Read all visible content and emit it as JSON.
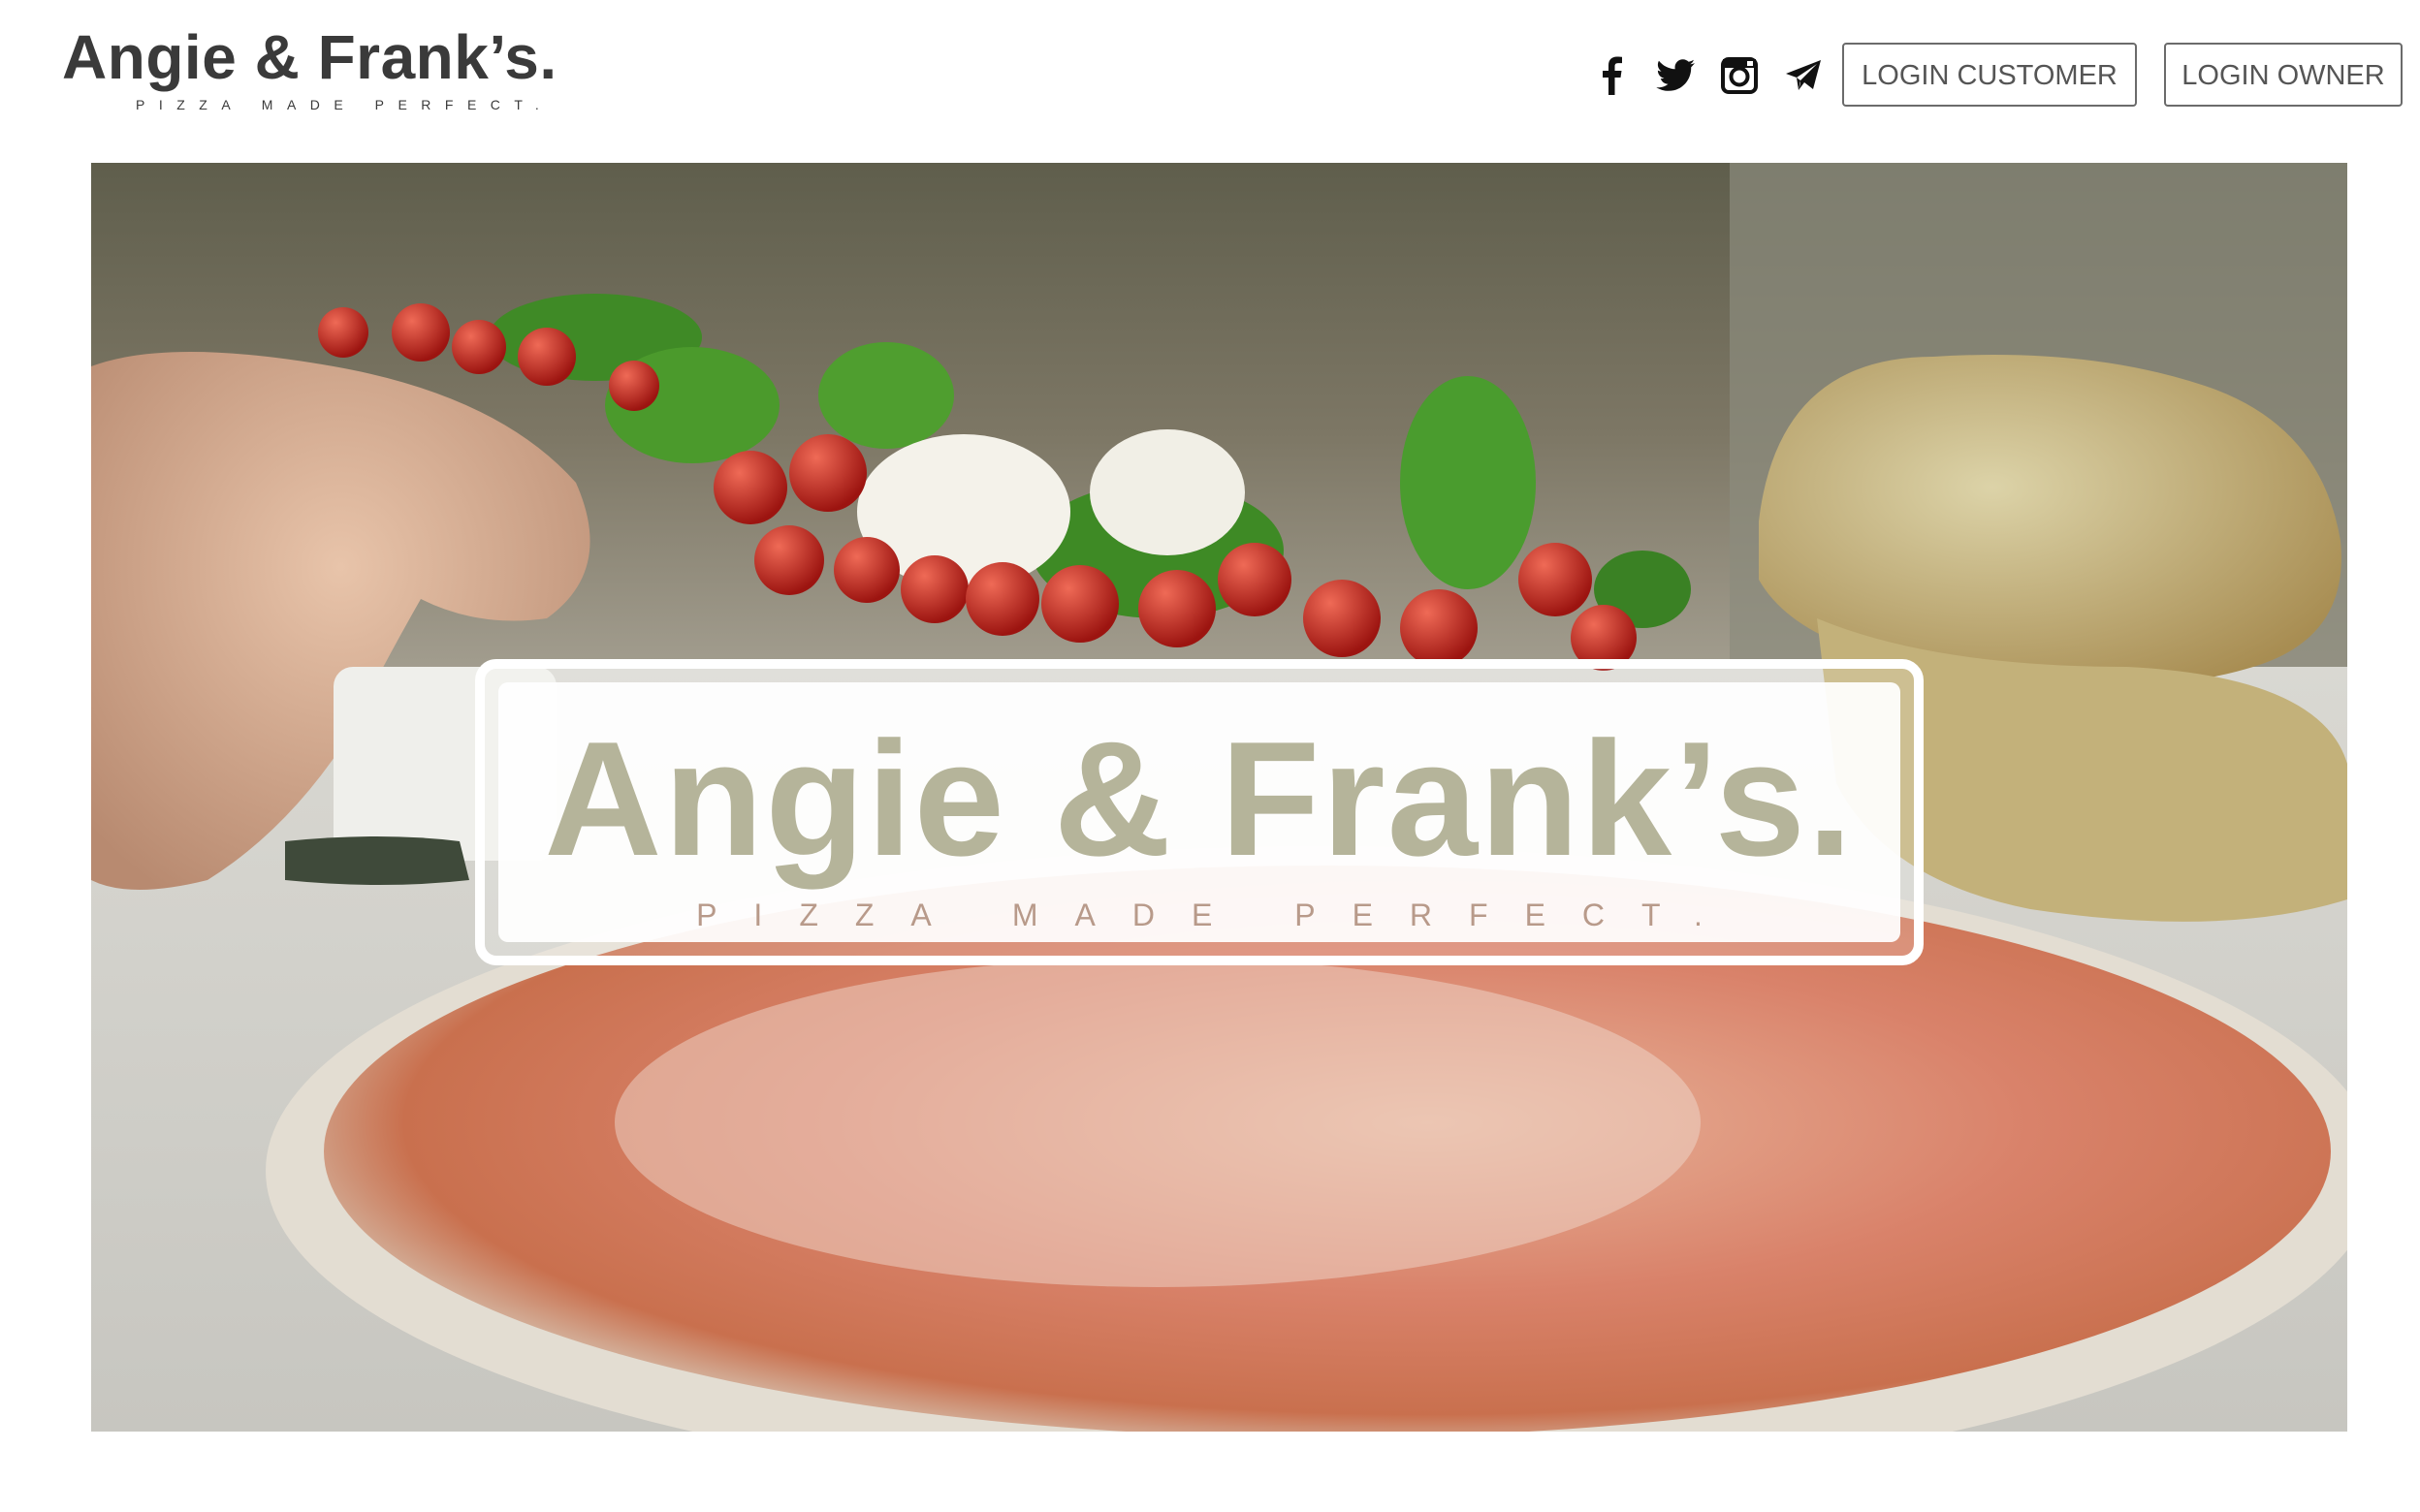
{
  "header": {
    "logo_title": "Angie & Frank’s.",
    "logo_tagline": "PIZZA MADE PERFECT.",
    "social": [
      {
        "icon": "facebook-icon"
      },
      {
        "icon": "twitter-icon"
      },
      {
        "icon": "instagram-icon"
      },
      {
        "icon": "telegram-icon"
      }
    ],
    "login_customer_label": "LOGIN CUSTOMER",
    "login_owner_label": "LOGIN OWNER"
  },
  "hero": {
    "title": "Angie & Frank’s.",
    "tagline": "PIZZA MADE PERFECT."
  },
  "colors": {
    "text_dark": "#3a3a3a",
    "button_border": "#6b6b6b",
    "button_text": "#555555",
    "background": "#ffffff"
  }
}
